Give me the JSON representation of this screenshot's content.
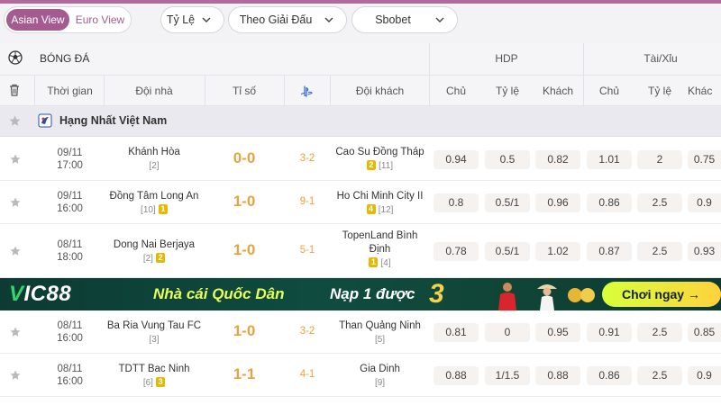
{
  "view_toggle": {
    "asian": "Asian View",
    "euro": "Euro View"
  },
  "filters": {
    "odds_type": "Tỷ Lệ",
    "sort": "Theo Giải Đấu",
    "bookmaker": "Sbobet"
  },
  "header": {
    "sport": "BÓNG ĐÁ",
    "hdp": "HDP",
    "taixiu": "Tài/Xỉu",
    "cols": {
      "time": "Thời gian",
      "home": "Đội nhà",
      "score": "Tỉ số",
      "away": "Đội khách",
      "hdp_home": "Chủ",
      "hdp_line": "Tỷ lệ",
      "hdp_away": "Khách",
      "ou_over": "Chủ",
      "ou_line": "Tỷ lệ",
      "ou_under": "Khác"
    }
  },
  "league": {
    "name": "Hạng Nhất Việt Nam"
  },
  "matches": [
    {
      "date": "09/11",
      "time": "17:00",
      "home": "Khánh Hòa",
      "home_rank": "[2]",
      "home_badge": "",
      "score": "0-0",
      "ht": "3-2",
      "away": "Cao Su Đồng Tháp",
      "away_badge": "2",
      "away_rank": "[11]",
      "hdp_home": "0.94",
      "hdp_line": "0.5",
      "hdp_away": "0.82",
      "ou_over": "1.01",
      "ou_line": "2",
      "ou_under": "0.75"
    },
    {
      "date": "09/11",
      "time": "16:00",
      "home": "Đồng Tâm Long An",
      "home_rank": "[10]",
      "home_badge": "1",
      "score": "1-0",
      "ht": "9-1",
      "away": "Ho Chi Minh City II",
      "away_badge": "4",
      "away_rank": "[12]",
      "hdp_home": "0.8",
      "hdp_line": "0.5/1",
      "hdp_away": "0.96",
      "ou_over": "0.86",
      "ou_line": "2.5",
      "ou_under": "0.9"
    },
    {
      "date": "08/11",
      "time": "18:00",
      "home": "Dong Nai Berjaya",
      "home_rank": "[2]",
      "home_badge": "2",
      "score": "1-0",
      "ht": "5-1",
      "away": "TopenLand Bình Định",
      "away_badge": "1",
      "away_rank": "[4]",
      "hdp_home": "0.78",
      "hdp_line": "0.5/1",
      "hdp_away": "1.02",
      "ou_over": "0.87",
      "ou_line": "2.5",
      "ou_under": "0.93"
    },
    {
      "date": "08/11",
      "time": "16:00",
      "home": "Ba Ria Vung Tau FC",
      "home_rank": "[3]",
      "home_badge": "",
      "score": "1-0",
      "ht": "3-2",
      "away": "Than Quảng Ninh",
      "away_badge": "",
      "away_rank": "[5]",
      "hdp_home": "0.81",
      "hdp_line": "0",
      "hdp_away": "0.95",
      "ou_over": "0.91",
      "ou_line": "2.5",
      "ou_under": "0.85"
    },
    {
      "date": "08/11",
      "time": "16:00",
      "home": "TDTT Bac Ninh",
      "home_rank": "[6]",
      "home_badge": "3",
      "score": "1-1",
      "ht": "4-1",
      "away": "Gia Dinh",
      "away_badge": "",
      "away_rank": "[9]",
      "hdp_home": "0.88",
      "hdp_line": "1/1.5",
      "hdp_away": "0.88",
      "ou_over": "0.86",
      "ou_line": "2.5",
      "ou_under": "0.9"
    }
  ],
  "banner": {
    "brand_v": "V",
    "brand_rest": "IC88",
    "slogan": "Nhà cái Quốc Dân",
    "promo": "Nạp 1 được",
    "promo_num": "3",
    "cta": "Chơi ngay →"
  },
  "colors": {
    "accent": "#a45c90",
    "score": "#e8a33c",
    "badge": "#e8b800"
  }
}
